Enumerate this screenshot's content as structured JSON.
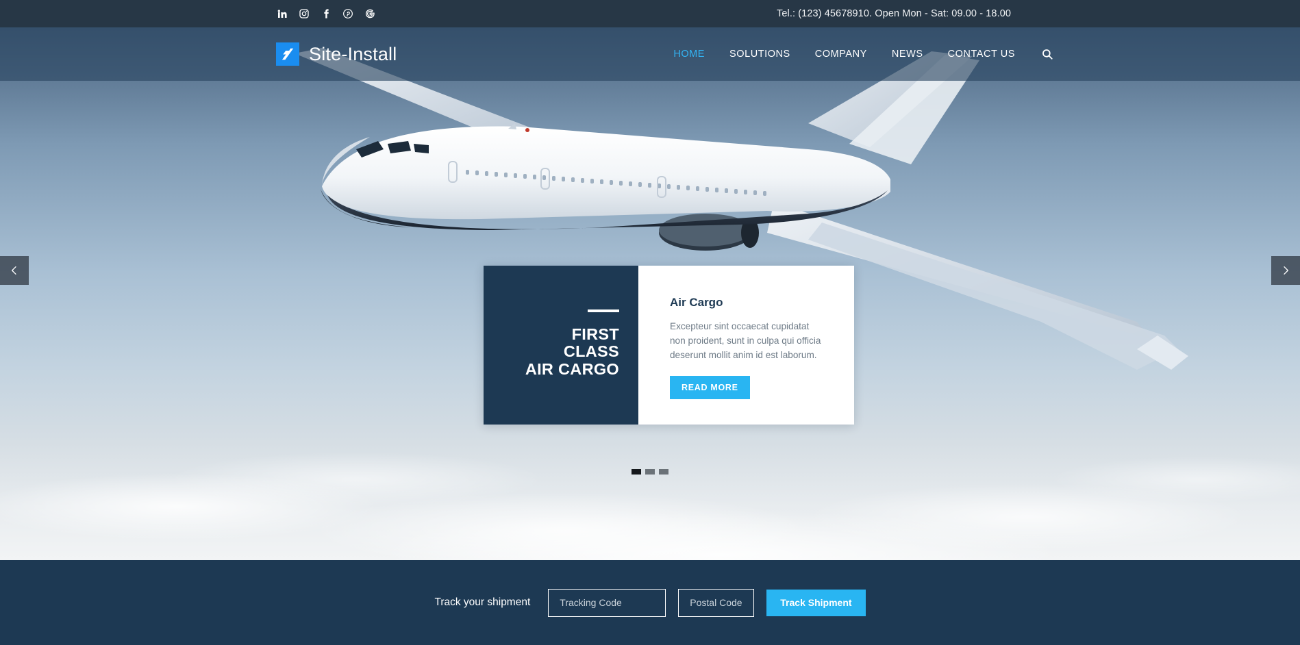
{
  "topbar": {
    "contact": "Tel.: (123) 45678910. Open Mon - Sat: 09.00 - 18.00",
    "social": [
      {
        "name": "linkedin-icon",
        "label": "LinkedIn"
      },
      {
        "name": "instagram-icon",
        "label": "Instagram"
      },
      {
        "name": "facebook-icon",
        "label": "Facebook"
      },
      {
        "name": "pinterest-icon",
        "label": "Pinterest"
      },
      {
        "name": "google-icon",
        "label": "Google"
      }
    ],
    "background": "#273746"
  },
  "header": {
    "brand_name": "Site-Install",
    "brand_color": "#1a8df0",
    "nav": [
      {
        "label": "HOME",
        "active": true
      },
      {
        "label": "SOLUTIONS",
        "active": false
      },
      {
        "label": "COMPANY",
        "active": false
      },
      {
        "label": "NEWS",
        "active": false
      },
      {
        "label": "CONTACT US",
        "active": false
      }
    ],
    "active_color": "#33b5f5"
  },
  "hero": {
    "slide": {
      "kicker_rule": true,
      "title_lines": [
        "FIRST",
        "CLASS",
        "AIR CARGO"
      ],
      "heading": "Air Cargo",
      "body": "Excepteur sint occaecat cupidatat non proident, sunt in culpa qui officia deserunt mollit anim id est laborum.",
      "cta_label": "READ MORE",
      "cta_color": "#29b5f2",
      "panel_color": "#1d3953"
    },
    "arrows": {
      "prev": "‹",
      "next": "›"
    },
    "dots": [
      {
        "active": true
      },
      {
        "active": false
      },
      {
        "active": false
      }
    ]
  },
  "trackbar": {
    "label": "Track your shipment",
    "tracking_placeholder": "Tracking Code",
    "tracking_value": "",
    "postal_placeholder": "Postal Code",
    "postal_value": "",
    "button_label": "Track Shipment",
    "background": "#1d3953",
    "button_color": "#29b5f2"
  }
}
